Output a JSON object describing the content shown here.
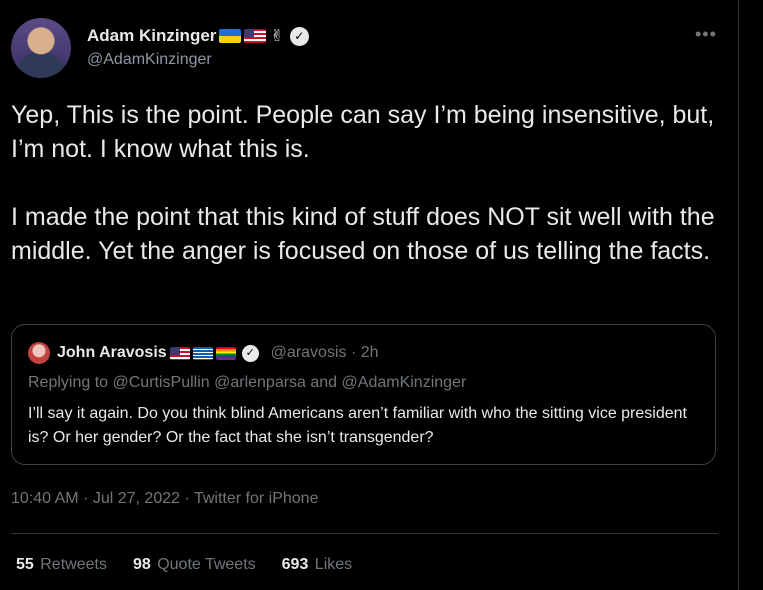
{
  "author": {
    "display_name": "Adam Kinzinger",
    "handle": "@AdamKinzinger",
    "emoji_flags": [
      "flag-ukraine",
      "flag-usa"
    ],
    "emoji_peace": "✌",
    "verified_icon": "verified-badge-icon"
  },
  "menu": {
    "more_glyph": "•••"
  },
  "tweet": {
    "paragraphs": [
      "Yep, This is the point.  People can say I’m being insensitive, but, I’m not.  I know what this is.",
      "I made the point that this kind of stuff does NOT sit well with the middle.  Yet the anger is focused on those of us telling the facts."
    ]
  },
  "quote": {
    "display_name": "John Aravosis",
    "handle": "@aravosis",
    "time": "2h",
    "separator": "·",
    "emoji_flags": [
      "flag-usa",
      "flag-greece",
      "flag-rainbow"
    ],
    "replying_to": "Replying to @CurtisPullin @arlenparsa and @AdamKinzinger",
    "text": "I’ll say it again. Do you think blind Americans aren’t familiar with who the sitting vice president is? Or her gender? Or the fact that she isn’t transgender?"
  },
  "meta": {
    "time": "10:40 AM",
    "sep1": "·",
    "date": "Jul 27, 2022",
    "sep2": "·",
    "source": "Twitter for iPhone"
  },
  "stats": {
    "retweets": {
      "count": "55",
      "label": "Retweets"
    },
    "quote_tweets": {
      "count": "98",
      "label": "Quote Tweets"
    },
    "likes": {
      "count": "693",
      "label": "Likes"
    }
  },
  "colors": {
    "background": "#000000",
    "text_primary": "#e7e9ea",
    "text_secondary": "#71767b",
    "border": "#2f3336"
  }
}
